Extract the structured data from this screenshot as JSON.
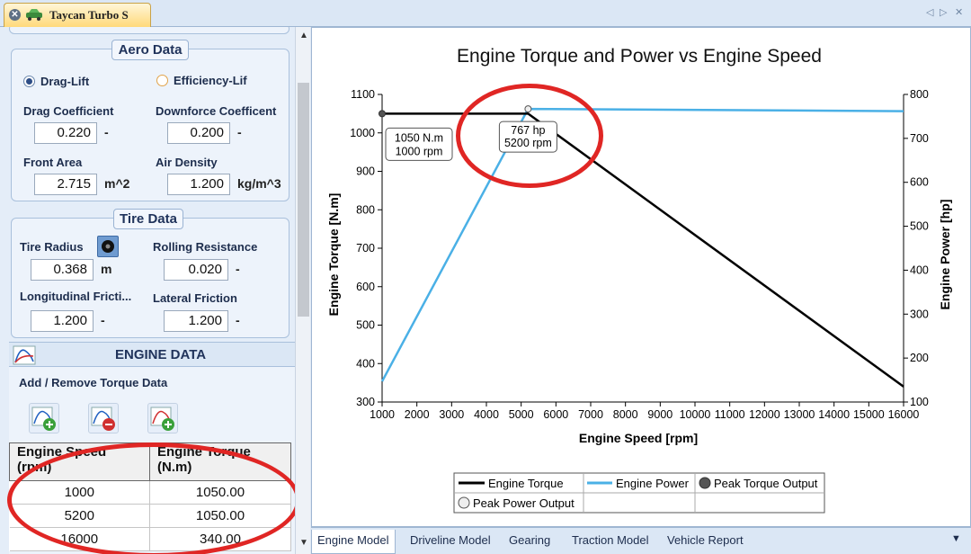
{
  "document_tab": {
    "title": "Taycan Turbo S",
    "nav_left": "◁",
    "nav_right": "▷",
    "close": "✕"
  },
  "aero": {
    "title": "Aero Data",
    "mode_options": [
      "Drag-Lift",
      "Efficiency-Lif"
    ],
    "drag_coefficient": {
      "label": "Drag Coefficient",
      "value": "0.220",
      "unit": "-"
    },
    "downforce_coefficient": {
      "label": "Downforce Coefficent",
      "value": "0.200",
      "unit": "-"
    },
    "front_area": {
      "label": "Front Area",
      "value": "2.715",
      "unit": "m^2"
    },
    "air_density": {
      "label": "Air Density",
      "value": "1.200",
      "unit": "kg/m^3"
    }
  },
  "tire": {
    "title": "Tire Data",
    "tire_radius": {
      "label": "Tire Radius",
      "value": "0.368",
      "unit": "m"
    },
    "rolling_resistance": {
      "label": "Rolling Resistance",
      "value": "0.020",
      "unit": "-"
    },
    "longitudinal_friction": {
      "label": "Longitudinal Fricti...",
      "value": "1.200",
      "unit": "-"
    },
    "lateral_friction": {
      "label": "Lateral Friction",
      "value": "1.200",
      "unit": "-"
    }
  },
  "engine": {
    "title": "ENGINE DATA",
    "subtitle": "Add / Remove Torque Data",
    "columns": [
      "Engine Speed (rpm)",
      "Engine Torque (N.m)"
    ],
    "rows": [
      [
        "1000",
        "1050.00"
      ],
      [
        "5200",
        "1050.00"
      ],
      [
        "16000",
        "340.00"
      ]
    ]
  },
  "bottom_tabs": [
    "Engine Model",
    "Driveline Model",
    "Gearing",
    "Traction Model",
    "Vehicle Report"
  ],
  "colors": {
    "torque": "#000000",
    "power": "#4ab0e6",
    "highlight": "#e02624"
  },
  "chart_data": {
    "type": "line",
    "title": "Engine Torque and Power vs Engine Speed",
    "xlabel": "Engine Speed [rpm]",
    "ylabel": "Engine Torque [N.m]",
    "y2label": "Engine Power [hp]",
    "xlim": [
      1000,
      16000
    ],
    "ylim": [
      300,
      1100
    ],
    "y2lim": [
      100,
      800
    ],
    "x_ticks": [
      1000,
      2000,
      3000,
      4000,
      5000,
      6000,
      7000,
      8000,
      9000,
      10000,
      11000,
      12000,
      13000,
      14000,
      15000,
      16000
    ],
    "y_ticks": [
      300,
      400,
      500,
      600,
      700,
      800,
      900,
      1000,
      1100
    ],
    "y2_ticks": [
      100,
      200,
      300,
      400,
      500,
      600,
      700,
      800
    ],
    "grid": false,
    "legend_position": "bottom",
    "series": [
      {
        "name": "Engine Torque",
        "axis": "left",
        "x": [
          1000,
          5200,
          16000
        ],
        "y": [
          1050,
          1050,
          340
        ]
      },
      {
        "name": "Engine Power",
        "axis": "right",
        "x": [
          1000,
          5200,
          16000
        ],
        "y": [
          147,
          767,
          762
        ]
      }
    ],
    "markers": [
      {
        "name": "Peak Torque Output",
        "x": 1000,
        "y": 1050,
        "axis": "left",
        "label": [
          "1050 N.m",
          "1000 rpm"
        ]
      },
      {
        "name": "Peak Power Output",
        "x": 5200,
        "y": 767,
        "axis": "right",
        "label": [
          "767 hp",
          "5200 rpm"
        ]
      }
    ],
    "legend": [
      "Engine Torque",
      "Engine Power",
      "Peak Torque Output",
      "Peak Power Output"
    ]
  }
}
